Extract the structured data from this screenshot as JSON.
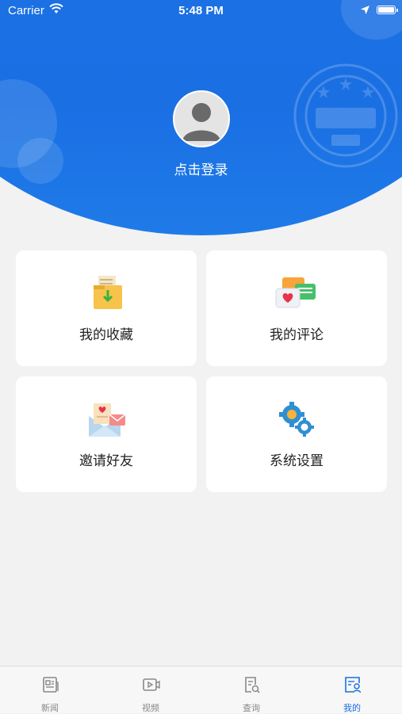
{
  "status_bar": {
    "carrier": "Carrier",
    "time": "5:48 PM"
  },
  "profile": {
    "login_text": "点击登录"
  },
  "menu": [
    {
      "label": "我的收藏",
      "icon": "favorites-folder-icon"
    },
    {
      "label": "我的评论",
      "icon": "comments-bubbles-icon"
    },
    {
      "label": "邀请好友",
      "icon": "invite-envelope-icon"
    },
    {
      "label": "系统设置",
      "icon": "settings-gears-icon"
    }
  ],
  "tabs": [
    {
      "label": "新闻",
      "icon": "news-icon",
      "active": false
    },
    {
      "label": "视频",
      "icon": "video-icon",
      "active": false
    },
    {
      "label": "查询",
      "icon": "search-document-icon",
      "active": false
    },
    {
      "label": "我的",
      "icon": "profile-icon",
      "active": true
    }
  ],
  "colors": {
    "primary": "#1a6fe3",
    "background": "#f2f2f2",
    "tab_inactive": "#888888"
  }
}
